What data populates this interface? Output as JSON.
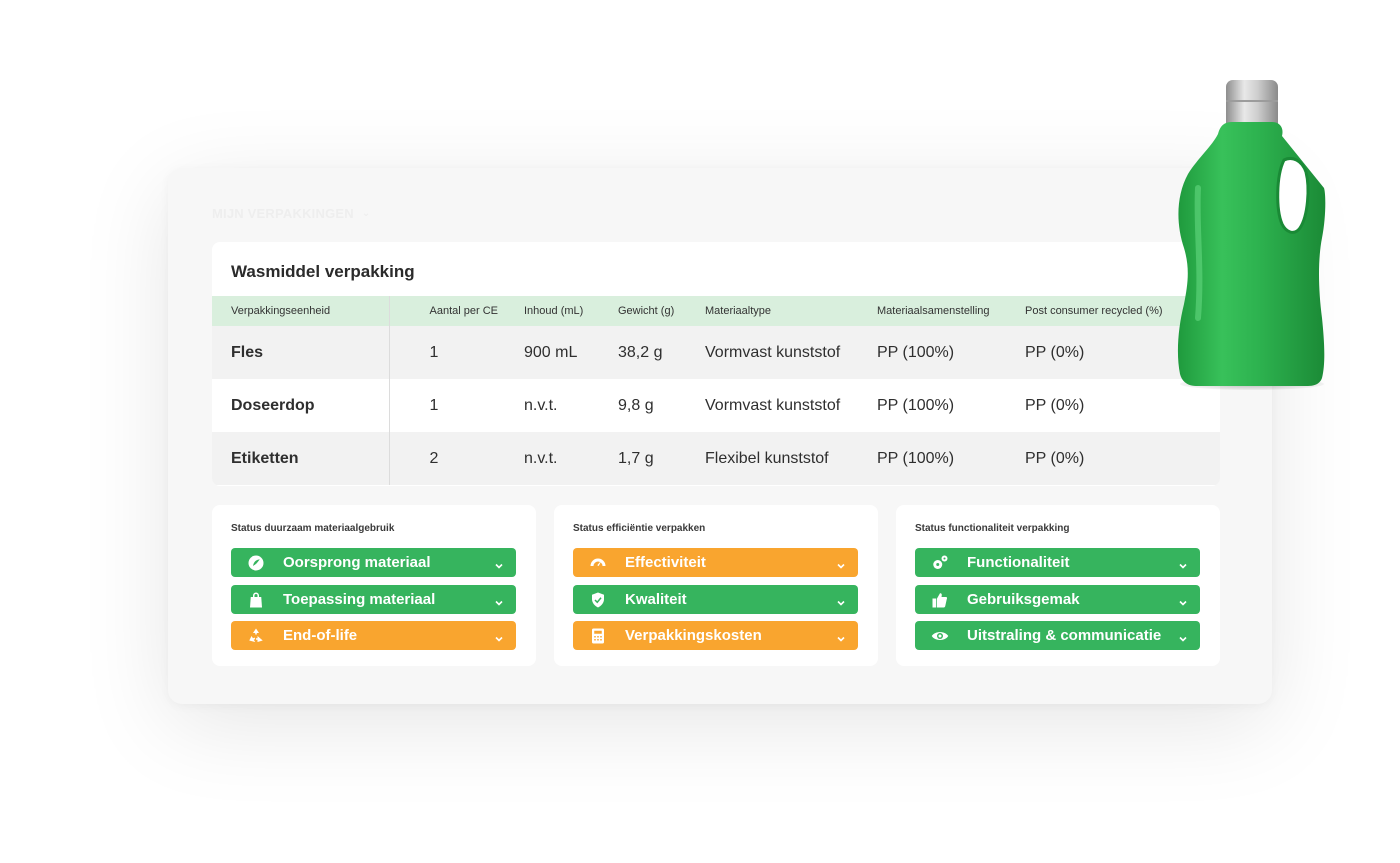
{
  "breadcrumb": {
    "label": "MIJN VERPAKKINGEN"
  },
  "table": {
    "title": "Wasmiddel verpakking",
    "headers": [
      "Verpakkingseenheid",
      "Aantal per CE",
      "Inhoud (mL)",
      "Gewicht (g)",
      "Materiaaltype",
      "Materiaalsamenstelling",
      "Post consumer recycled (%)"
    ],
    "rows": [
      [
        "Fles",
        "1",
        "900 mL",
        "38,2 g",
        "Vormvast kunststof",
        "PP (100%)",
        "PP (0%)"
      ],
      [
        "Doseerdop",
        "1",
        "n.v.t.",
        "9,8 g",
        "Vormvast kunststof",
        "PP (100%)",
        "PP (0%)"
      ],
      [
        "Etiketten",
        "2",
        "n.v.t.",
        "1,7 g",
        "Flexibel kunststof",
        "PP (100%)",
        "PP (0%)"
      ]
    ]
  },
  "status": [
    {
      "title": "Status duurzaam materiaalgebruik",
      "items": [
        {
          "label": "Oorsprong materiaal",
          "color": "#36b45e",
          "icon": "leaf-icon"
        },
        {
          "label": "Toepassing materiaal",
          "color": "#36b45e",
          "icon": "shopping-bag-icon"
        },
        {
          "label": "End-of-life",
          "color": "#f9a52f",
          "icon": "recycle-icon"
        }
      ]
    },
    {
      "title": "Status efficiëntie verpakken",
      "items": [
        {
          "label": "Effectiviteit",
          "color": "#f9a52f",
          "icon": "gauge-icon"
        },
        {
          "label": "Kwaliteit",
          "color": "#36b45e",
          "icon": "shield-check-icon"
        },
        {
          "label": "Verpakkingskosten",
          "color": "#f9a52f",
          "icon": "calculator-icon"
        }
      ]
    },
    {
      "title": "Status functionaliteit verpakking",
      "items": [
        {
          "label": "Functionaliteit",
          "color": "#36b45e",
          "icon": "gears-icon"
        },
        {
          "label": "Gebruiksgemak",
          "color": "#36b45e",
          "icon": "thumbs-up-icon"
        },
        {
          "label": "Uitstraling & communicatie",
          "color": "#36b45e",
          "icon": "eye-icon"
        }
      ]
    }
  ],
  "colors": {
    "green": "#36b45e",
    "orange": "#f9a52f",
    "header_green": "#d9efdd",
    "bottle_green": "#2fb24f"
  },
  "image": {
    "icon": "detergent-bottle-icon"
  }
}
